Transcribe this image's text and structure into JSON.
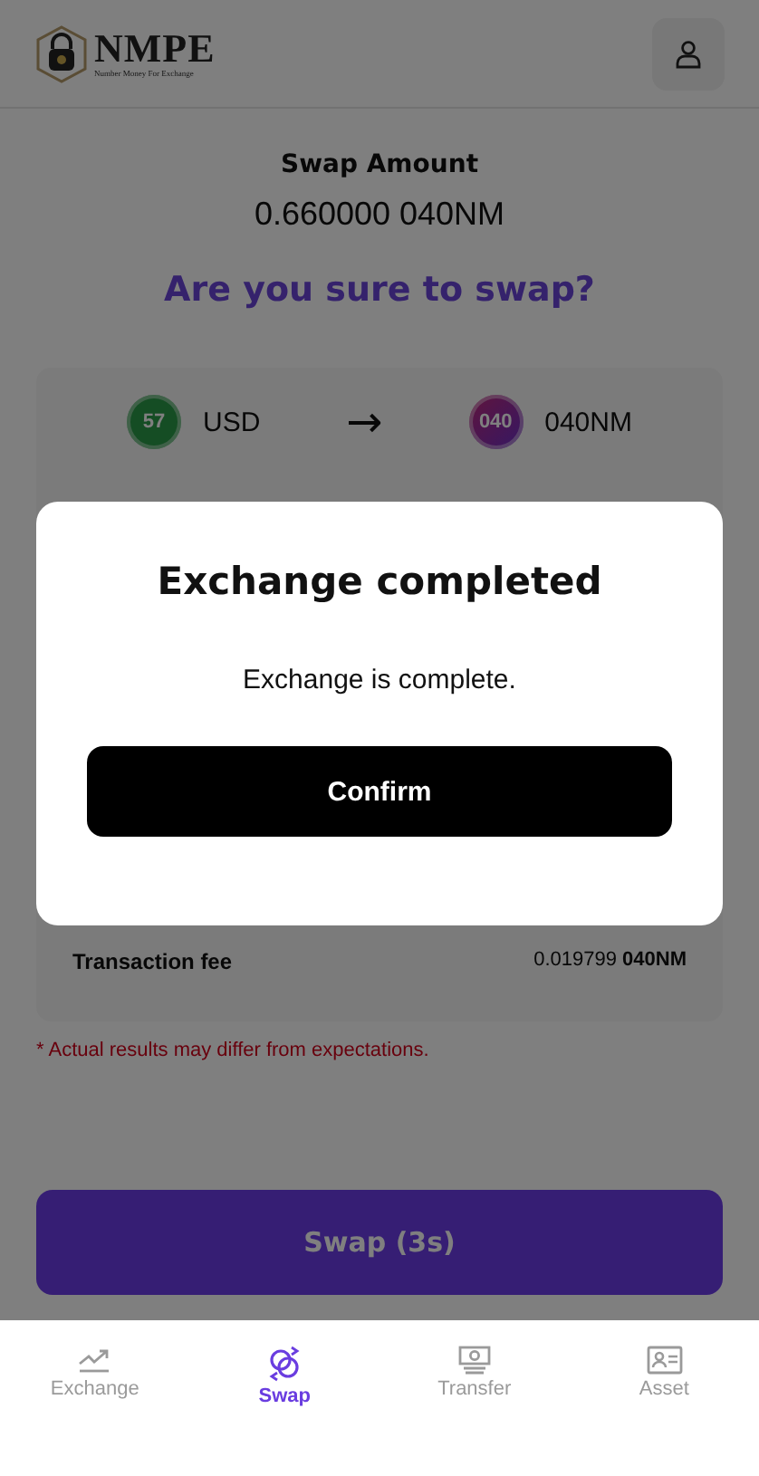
{
  "header": {
    "logo_name": "NMPE",
    "logo_tagline": "Number Money For Exchange"
  },
  "swap_amount": {
    "label": "Swap Amount",
    "value": "0.660000 040NM"
  },
  "question": "Are you sure to swap?",
  "pair": {
    "from": {
      "coin": "57",
      "name": "USD"
    },
    "arrow": "→",
    "to": {
      "coin": "040",
      "name": "040NM"
    }
  },
  "fee": {
    "label": "Transaction fee",
    "value": "0.019799",
    "unit": "040NM"
  },
  "note": "* Actual results may differ from expectations.",
  "swap_button": "Swap (3s)",
  "modal": {
    "title": "Exchange completed",
    "message": "Exchange is complete.",
    "button": "Confirm"
  },
  "nav": [
    {
      "label": "Exchange",
      "selected": false
    },
    {
      "label": "Swap",
      "selected": true
    },
    {
      "label": "Transfer",
      "selected": false
    },
    {
      "label": "Asset",
      "selected": false
    }
  ]
}
